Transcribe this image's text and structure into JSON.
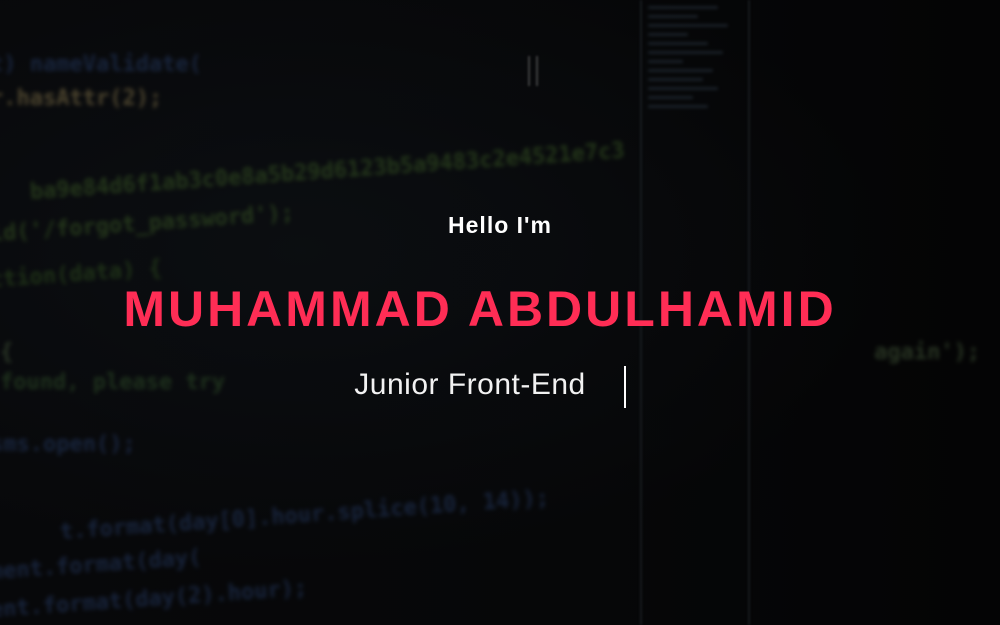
{
  "hero": {
    "greeting": "Hello I'm",
    "name": "MUHAMMAD ABDULHAMID",
    "role": "Junior Front-End"
  },
  "colors": {
    "accent": "#ff2d55",
    "text": "#ffffff",
    "background": "#0a0a0c"
  }
}
